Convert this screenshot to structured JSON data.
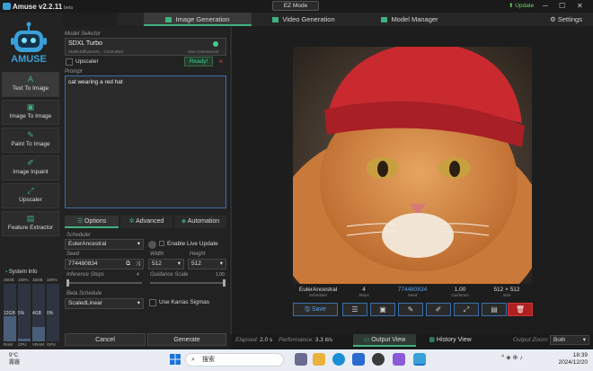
{
  "app": {
    "title": "Amuse v2.2.11",
    "beta": "beta",
    "ez_mode": "EZ Mode",
    "update": "Update",
    "settings": "Settings",
    "logo_text": "AMUSE"
  },
  "top_tabs": [
    {
      "label": "Image Generation",
      "active": true
    },
    {
      "label": "Video Generation",
      "active": false
    },
    {
      "label": "Model Manager",
      "active": false
    }
  ],
  "nav": [
    {
      "label": "Text To Image",
      "icon": "A"
    },
    {
      "label": "Image To Image",
      "icon": "▣"
    },
    {
      "label": "Paint To Image",
      "icon": "✎"
    },
    {
      "label": "Image Inpaint",
      "icon": "✐"
    },
    {
      "label": "Upscaler",
      "icon": "⤢"
    },
    {
      "label": "Feature Extractor",
      "icon": "▤"
    }
  ],
  "system_info": {
    "title": "System Info",
    "top_labels": [
      "28GB",
      "100%",
      "16GB",
      "100%"
    ],
    "values": [
      "12GB",
      "5%",
      "4GB",
      "0%"
    ],
    "bottom_labels": [
      "RAM",
      "CPU",
      "VRAM",
      "GPU"
    ],
    "levels": [
      0.43,
      0.05,
      0.25,
      0.0
    ]
  },
  "model": {
    "section": "Model Selector",
    "name": "SDXL Turbo",
    "sub": "StableDiffusionXL - ControlNet",
    "license": "Non-Commercial",
    "upscaler": "Upscaler",
    "ready": "Ready!",
    "close": "×"
  },
  "prompt": {
    "label": "Prompt",
    "text": "cat wearing a red hat"
  },
  "sub_tabs": [
    {
      "label": "Options",
      "active": true
    },
    {
      "label": "Advanced",
      "active": false
    },
    {
      "label": "Automation",
      "active": false
    }
  ],
  "options": {
    "scheduler_label": "Scheduler",
    "scheduler": "EulerAncestral",
    "live_update": "Enable Live Update",
    "seed_label": "Seed",
    "seed": "774480834",
    "width_label": "Width",
    "width": "512",
    "height_label": "Height",
    "height": "512",
    "steps_label": "Inference Steps",
    "steps": "4",
    "guidance_label": "Guidance Scale",
    "guidance": "1.00",
    "beta_label": "Beta Schedule",
    "beta": "ScaledLinear",
    "karras": "Use Karras Sigmas"
  },
  "actions": {
    "cancel": "Cancel",
    "generate": "Generate"
  },
  "result_meta": [
    {
      "value": "EulerAncestral",
      "label": "Scheduler"
    },
    {
      "value": "4",
      "label": "Steps"
    },
    {
      "value": "774480834",
      "label": "Seed"
    },
    {
      "value": "1.00",
      "label": "Guidance"
    },
    {
      "value": "512 × 512",
      "label": "Size"
    }
  ],
  "toolbar": {
    "save": "Save"
  },
  "status": {
    "elapsed_label": "Elapsed:",
    "elapsed": "2.0 s",
    "perf_label": "Performance:",
    "perf": "3.3 it/s",
    "output_view": "Output View",
    "history_view": "History View",
    "zoom_label": "Output Zoom:",
    "zoom": "Both"
  },
  "taskbar": {
    "temp": "9°C",
    "weather": "霧霾",
    "search": "搜索",
    "time": "18:39",
    "date": "2024/12/20"
  },
  "colors": {
    "accent": "#3fb27f",
    "hat_red": "#c82a2f",
    "cat_orange": "#d9893e"
  }
}
